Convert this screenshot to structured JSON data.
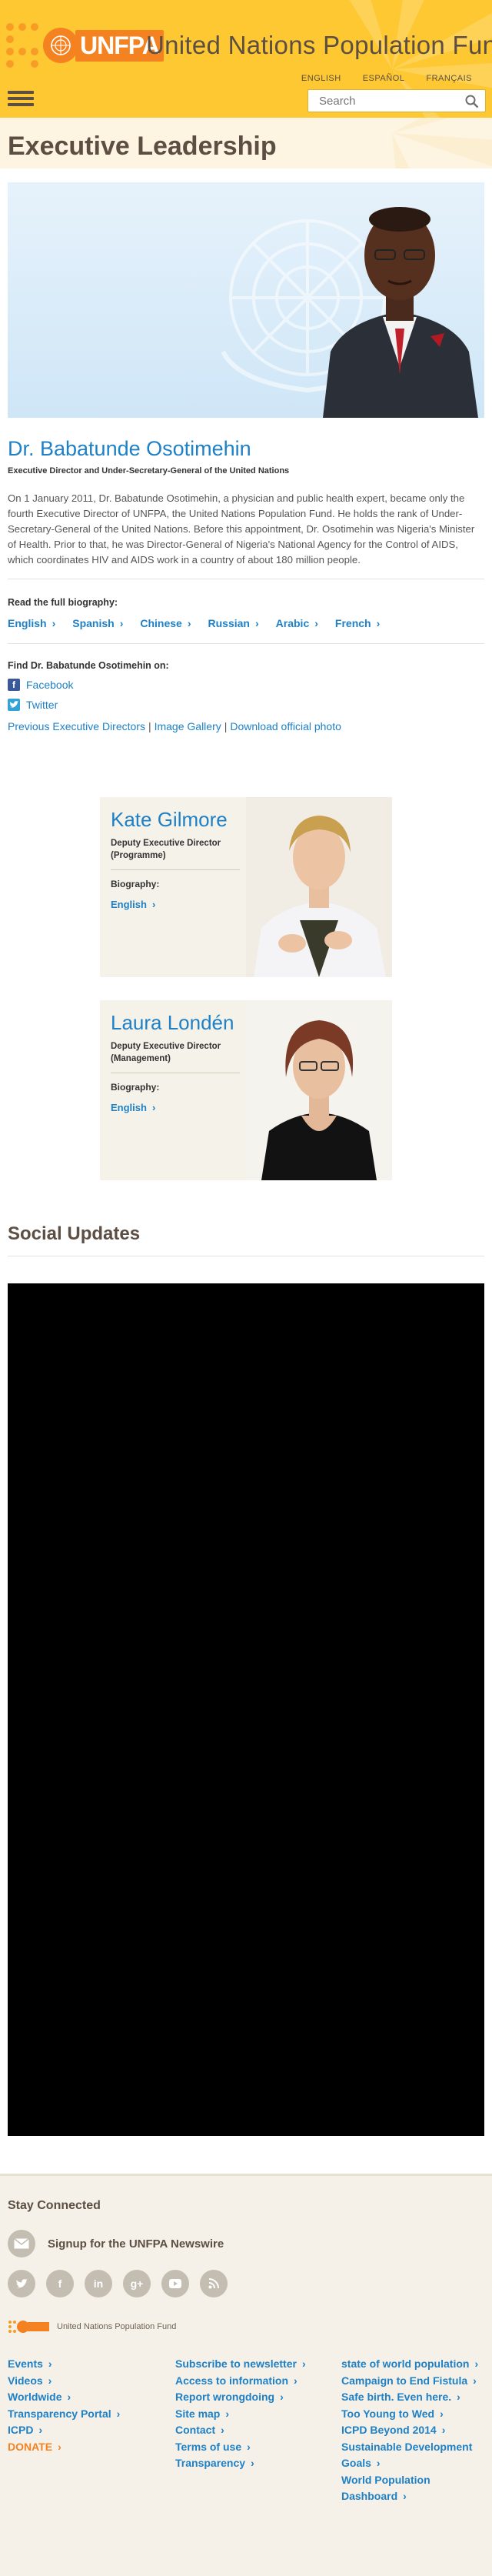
{
  "header": {
    "logo_text": "UNFPA",
    "site_title": "United Nations Population Fund",
    "languages": [
      "ENGLISH",
      "ESPAÑOL",
      "FRANÇAIS"
    ],
    "search_placeholder": "Search",
    "colors": {
      "header_bg": "#fdc832",
      "accent": "#f58220",
      "link": "#1e80c6",
      "title_brown": "#5c4e42"
    }
  },
  "page_title": "Executive Leadership",
  "executive": {
    "name": "Dr. Babatunde Osotimehin",
    "role": "Executive Director and Under-Secretary-General of the United Nations",
    "bio": "On 1 January 2011, Dr. Babatunde Osotimehin, a physician and public health expert, became only the fourth Executive Director of UNFPA, the United Nations Population Fund. He holds the rank of Under-Secretary-General of the United Nations. Before this appointment, Dr. Osotimehin was Nigeria's Minister of Health. Prior to that, he was Director-General of Nigeria's National Agency for the Control of AIDS, which coordinates HIV and AIDS work in a country of about 180 million people.",
    "full_bio_label": "Read the full biography:",
    "bio_languages": [
      "English",
      "Spanish",
      "Chinese",
      "Russian",
      "Arabic",
      "French"
    ],
    "find_label": "Find Dr. Babatunde Osotimehin on:",
    "social": [
      {
        "label": "Facebook",
        "icon": "facebook-icon",
        "color": "#3b5998"
      },
      {
        "label": "Twitter",
        "icon": "twitter-icon",
        "color": "#33a2d9"
      }
    ],
    "links": [
      "Previous Executive Directors",
      "Image Gallery",
      "Download official photo"
    ]
  },
  "deputies": [
    {
      "name": "Kate Gilmore",
      "role": "Deputy Executive Director (Programme)",
      "bio_label": "Biography:",
      "link": "English"
    },
    {
      "name": "Laura Londén",
      "role": "Deputy Executive Director (Management)",
      "bio_label": "Biography:",
      "link": "English"
    }
  ],
  "social_updates": {
    "title": "Social Updates"
  },
  "footer": {
    "stay_connected": "Stay Connected",
    "newswire": "Signup for the UNFPA Newswire",
    "social_icons": [
      "twitter-icon",
      "facebook-icon",
      "linkedin-icon",
      "googleplus-icon",
      "youtube-icon",
      "rss-icon"
    ],
    "logo_caption": "United Nations Population Fund",
    "col1": [
      "Events",
      "Videos",
      "Worldwide",
      "Transparency Portal",
      "ICPD",
      "DONATE"
    ],
    "col2": [
      "Subscribe to newsletter",
      "Access to information",
      "Report wrongdoing",
      "Site map",
      "Contact",
      "Terms of use",
      "Transparency"
    ],
    "col3": [
      "state of world population",
      "Campaign to End Fistula",
      "Safe birth. Even here.",
      "Too Young to Wed",
      "ICPD Beyond 2014",
      "Sustainable Development Goals",
      "World Population Dashboard"
    ]
  }
}
